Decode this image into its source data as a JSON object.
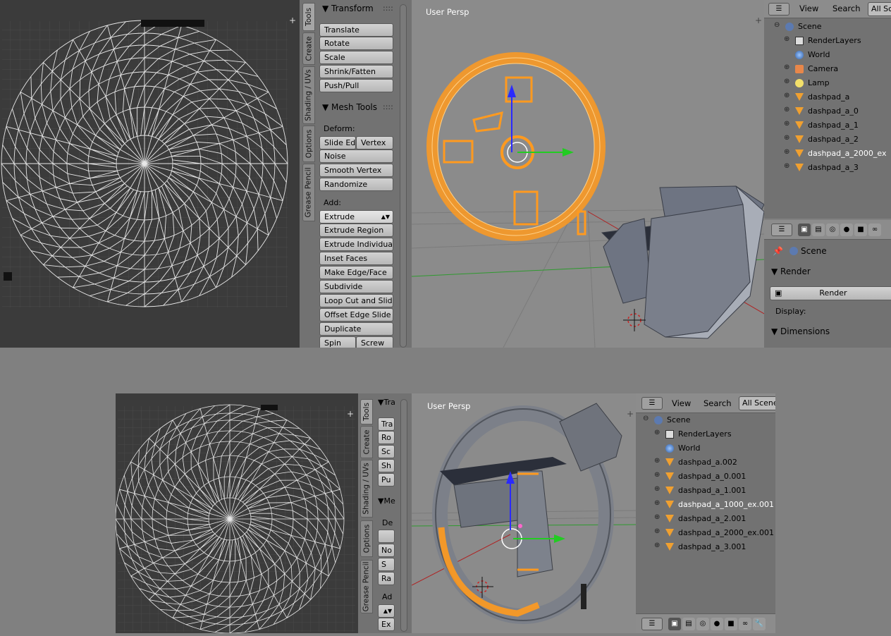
{
  "top": {
    "tabs": [
      "Tools",
      "Create",
      "Shading / UVs",
      "Options",
      "Grease Pencil"
    ],
    "transform": {
      "title": "Transform",
      "buttons": [
        "Translate",
        "Rotate",
        "Scale",
        "Shrink/Fatten",
        "Push/Pull"
      ]
    },
    "mesh_tools": {
      "title": "Mesh Tools",
      "deform_label": "Deform:",
      "slide_edge": "Slide Ed",
      "vertex": "Vertex",
      "deform_buttons": [
        "Noise",
        "Smooth Vertex",
        "Randomize"
      ],
      "add_label": "Add:",
      "extrude": "Extrude",
      "add_buttons": [
        "Extrude Region",
        "Extrude Individual",
        "Inset Faces",
        "Make Edge/Face",
        "Subdivide",
        "Loop Cut and Slide",
        "Offset Edge Slide",
        "Duplicate"
      ],
      "spin": "Spin",
      "screw": "Screw"
    },
    "viewport_label": "User Persp",
    "outliner": {
      "menu": [
        "View",
        "Search"
      ],
      "scene_selector": "All Sc",
      "rows": [
        {
          "name": "Scene",
          "icon": "scene-icon"
        },
        {
          "name": "RenderLayers",
          "icon": "renderlayers-icon"
        },
        {
          "name": "World",
          "icon": "world-icon"
        },
        {
          "name": "Camera",
          "icon": "camera-icon"
        },
        {
          "name": "Lamp",
          "icon": "lamp-icon"
        },
        {
          "name": "dashpad_a",
          "icon": "mesh-object-icon"
        },
        {
          "name": "dashpad_a_0",
          "icon": "mesh-object-icon"
        },
        {
          "name": "dashpad_a_1",
          "icon": "mesh-object-icon"
        },
        {
          "name": "dashpad_a_2",
          "icon": "mesh-object-icon"
        },
        {
          "name": "dashpad_a_2000_ex",
          "icon": "mesh-object-icon",
          "selected": true
        },
        {
          "name": "dashpad_a_3",
          "icon": "mesh-object-icon"
        }
      ]
    },
    "properties": {
      "scene": "Scene",
      "render_section": "Render",
      "render_button": "Render",
      "display_label": "Display:",
      "dimensions_section": "Dimensions"
    }
  },
  "bottom": {
    "tabs": [
      "Tools",
      "Create",
      "Shading / UVs",
      "Options",
      "Grease Pencil"
    ],
    "transform_title": "Tra",
    "transform_buttons": [
      "Tra",
      "Ro",
      "Sc",
      "Sh",
      "Pu"
    ],
    "mesh_title": "Me",
    "deform_label": "De",
    "deform_buttons": [
      "",
      "No",
      "S",
      "Ra"
    ],
    "add_label": "Ad",
    "add_buttons": [
      "Ex"
    ],
    "viewport_label": "User Persp",
    "outliner": {
      "menu": [
        "View",
        "Search"
      ],
      "scene_selector": "All Scenes",
      "rows": [
        {
          "name": "Scene",
          "icon": "scene-icon"
        },
        {
          "name": "RenderLayers",
          "icon": "renderlayers-icon"
        },
        {
          "name": "World",
          "icon": "world-icon"
        },
        {
          "name": "dashpad_a.002",
          "icon": "mesh-object-icon"
        },
        {
          "name": "dashpad_a_0.001",
          "icon": "mesh-object-icon"
        },
        {
          "name": "dashpad_a_1.001",
          "icon": "mesh-object-icon"
        },
        {
          "name": "dashpad_a_1000_ex.001",
          "icon": "mesh-object-icon",
          "selected": true
        },
        {
          "name": "dashpad_a_2.001",
          "icon": "mesh-object-icon"
        },
        {
          "name": "dashpad_a_2000_ex.001",
          "icon": "mesh-object-icon"
        },
        {
          "name": "dashpad_a_3.001",
          "icon": "mesh-object-icon"
        }
      ]
    }
  },
  "colors": {
    "selection": "#ff9a1f",
    "x_axis": "#ff2a2a",
    "y_axis": "#22cc22",
    "z_axis": "#2a2aff"
  }
}
